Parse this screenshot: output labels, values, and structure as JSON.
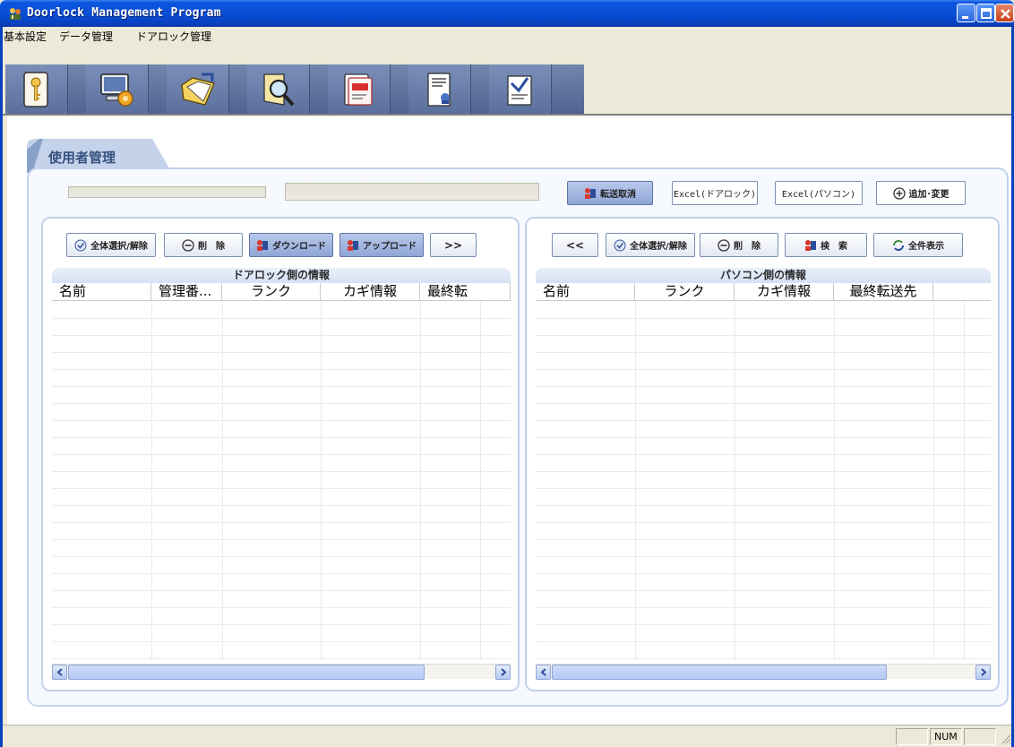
{
  "window": {
    "title": "Doorlock Management Program"
  },
  "menu": {
    "items": [
      "基本設定",
      "データ管理",
      "ドアロック管理"
    ]
  },
  "toolbar": {
    "icons": [
      "key-card-icon",
      "computer-settings-icon",
      "folder-transfer-icon",
      "search-magnifier-icon",
      "card-icon",
      "report-icon",
      "export-document-icon"
    ]
  },
  "section": {
    "title": "使用者管理"
  },
  "top_actions": {
    "cancel_transfer": "転送取消",
    "excel_doorlock": "Excel(ドアロック)",
    "excel_pc": "Excel(パソコン)",
    "add_change": "追加･変更"
  },
  "left_panel": {
    "title": "ドアロック側の情報",
    "buttons": {
      "select_all": "全体選択/解除",
      "delete": "削　除",
      "download": "ダウンロード",
      "upload": "アップロード",
      "move_right": ">>"
    },
    "columns": [
      "名前",
      "管理番...",
      "ランク",
      "カギ情報",
      "最終転"
    ]
  },
  "right_panel": {
    "title": "パソコン側の情報",
    "buttons": {
      "move_left": "<<",
      "select_all": "全体選択/解除",
      "delete": "削　除",
      "search": "検　索",
      "show_all": "全件表示"
    },
    "columns": [
      "名前",
      "ランク",
      "カギ情報",
      "最終転送先"
    ]
  },
  "status": {
    "num": "NUM"
  },
  "colors": {
    "titlebar": "#0a4fd6",
    "panel_border": "#c2d3ec",
    "accent_text": "#35507e"
  }
}
